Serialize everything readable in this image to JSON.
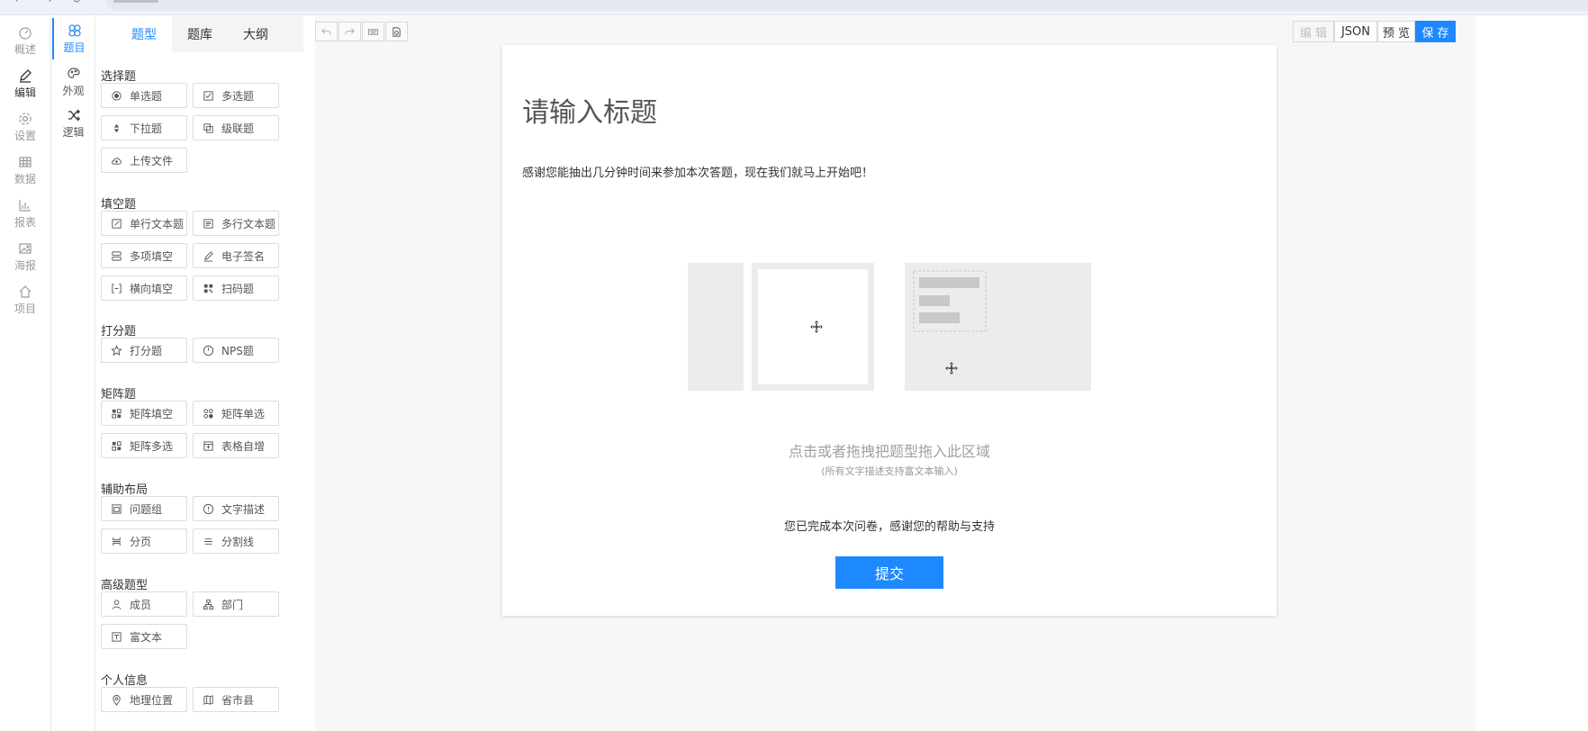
{
  "nav": {
    "items": [
      {
        "label": "概述",
        "icon": "dashboard-icon"
      },
      {
        "label": "编辑",
        "icon": "pen-icon",
        "active": true
      },
      {
        "label": "设置",
        "icon": "gear-icon"
      },
      {
        "label": "数据",
        "icon": "table-icon"
      },
      {
        "label": "报表",
        "icon": "bar-chart-icon"
      },
      {
        "label": "海报",
        "icon": "image-icon"
      },
      {
        "label": "项目",
        "icon": "home-icon"
      }
    ]
  },
  "subnav": {
    "items": [
      {
        "label": "题目",
        "icon": "flower-icon",
        "active": true
      },
      {
        "label": "外观",
        "icon": "palette-icon"
      },
      {
        "label": "逻辑",
        "icon": "shuffle-icon"
      }
    ]
  },
  "panel": {
    "tabs": [
      "题型",
      "题库",
      "大纲"
    ],
    "active_tab": "题型",
    "groups": [
      {
        "title": "选择题",
        "items": [
          "单选题",
          "多选题",
          "下拉题",
          "级联题",
          "上传文件"
        ]
      },
      {
        "title": "填空题",
        "items": [
          "单行文本题",
          "多行文本题",
          "多项填空",
          "电子签名",
          "横向填空",
          "扫码题"
        ]
      },
      {
        "title": "打分题",
        "items": [
          "打分题",
          "NPS题"
        ]
      },
      {
        "title": "矩阵题",
        "items": [
          "矩阵填空",
          "矩阵单选",
          "矩阵多选",
          "表格自增"
        ]
      },
      {
        "title": "辅助布局",
        "items": [
          "问题组",
          "文字描述",
          "分页",
          "分割线"
        ]
      },
      {
        "title": "高级题型",
        "items": [
          "成员",
          "部门",
          "富文本"
        ]
      },
      {
        "title": "个人信息",
        "items": [
          "地理位置",
          "省市县"
        ]
      }
    ]
  },
  "toolbar": {
    "tools": [
      "undo-icon",
      "redo-icon",
      "keyboard-icon",
      "preview-doc-icon"
    ]
  },
  "actions": {
    "edit": "编 辑",
    "json": "JSON",
    "preview": "预 览",
    "save": "保 存"
  },
  "survey": {
    "title": "请输入标题",
    "description": "感谢您能抽出几分钟时间来参加本次答题，现在我们就马上开始吧！",
    "drop_hint": "点击或者拖拽把题型拖入此区域",
    "drop_sub": "(所有文字描述支持富文本输入)",
    "finish_text": "您已完成本次问卷，感谢您的帮助与支持",
    "submit_label": "提交"
  },
  "colors": {
    "accent": "#1e88ff",
    "nav_text": "#9a9a9a",
    "canvas_bg": "#f7f7f7"
  }
}
